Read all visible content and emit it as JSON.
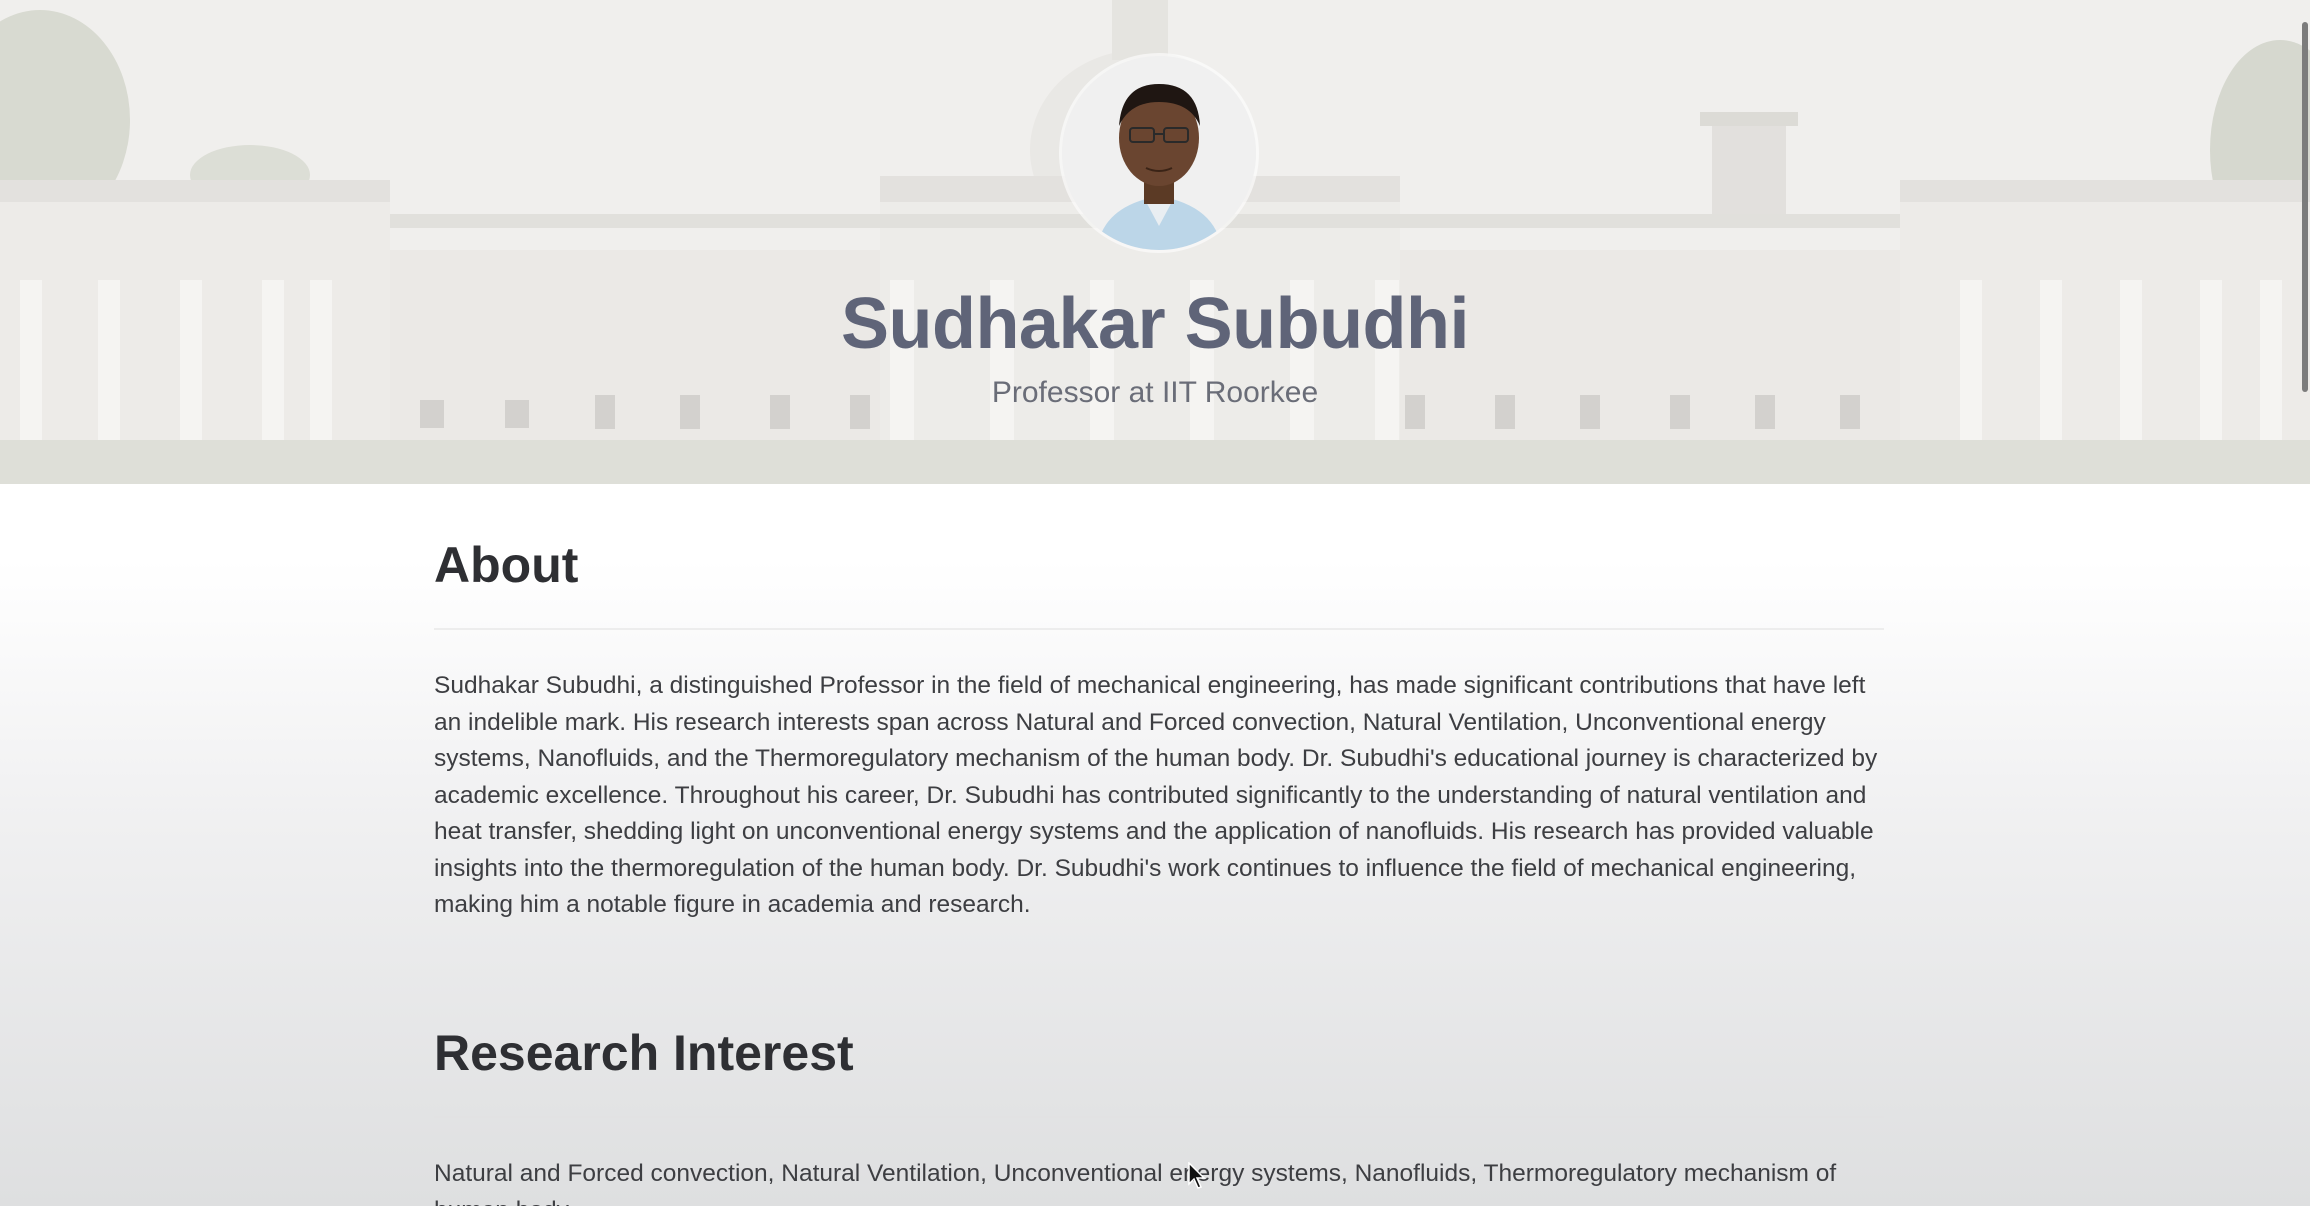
{
  "profile": {
    "name": "Sudhakar Subudhi",
    "subtitle": "Professor at IIT Roorkee"
  },
  "about": {
    "heading": "About",
    "text": "Sudhakar Subudhi, a distinguished Professor in the field of mechanical engineering, has made significant contributions that have left an indelible mark. His research interests span across Natural and Forced convection, Natural Ventilation, Unconventional energy systems, Nanofluids, and the Thermoregulatory mechanism of the human body. Dr. Subudhi's educational journey is characterized by academic excellence. Throughout his career, Dr. Subudhi has contributed significantly to the understanding of natural ventilation and heat transfer, shedding light on unconventional energy systems and the application of nanofluids. His research has provided valuable insights into the thermoregulation of the human body. Dr. Subudhi's work continues to influence the field of mechanical engineering, making him a notable figure in academia and research."
  },
  "research": {
    "heading": "Research Interest",
    "text": "Natural and Forced convection, Natural Ventilation, Unconventional energy systems, Nanofluids, Thermoregulatory mechanism of human body."
  },
  "icons": {
    "avatar": "profile-photo",
    "hero_background": "building-photo",
    "cursor": "mouse-pointer-icon"
  },
  "colors": {
    "name_text": "#5f6478",
    "heading_text": "#2e2f33",
    "body_text": "#3d3e42"
  }
}
